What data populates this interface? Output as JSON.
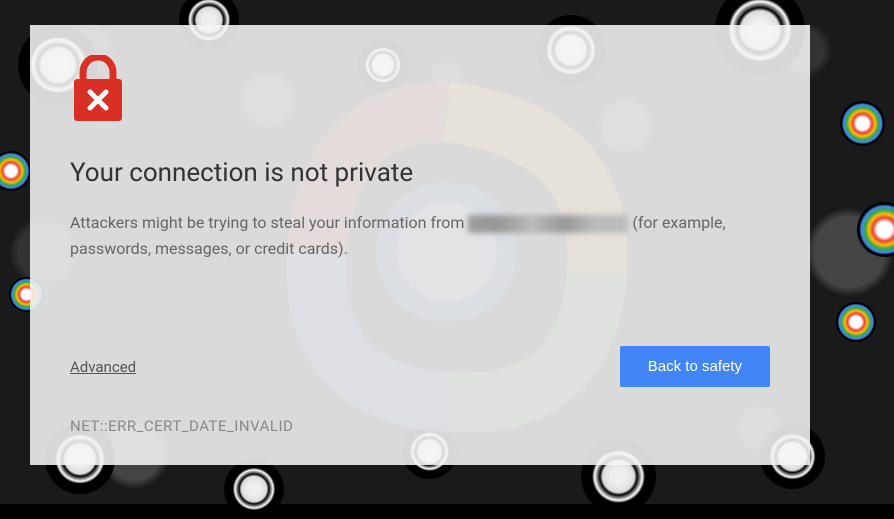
{
  "colors": {
    "danger": "#d93025",
    "primary_button": "#4285f4",
    "button_text": "#ffffff"
  },
  "icon": {
    "name": "lock-error-icon"
  },
  "warning": {
    "title": "Your connection is not private",
    "description_prefix": "Attackers might be trying to steal your information from ",
    "description_suffix": " (for example, passwords, messages, or credit cards).",
    "advanced_label": "Advanced",
    "safety_button_label": "Back to safety",
    "error_code": "NET::ERR_CERT_DATE_INVALID"
  }
}
